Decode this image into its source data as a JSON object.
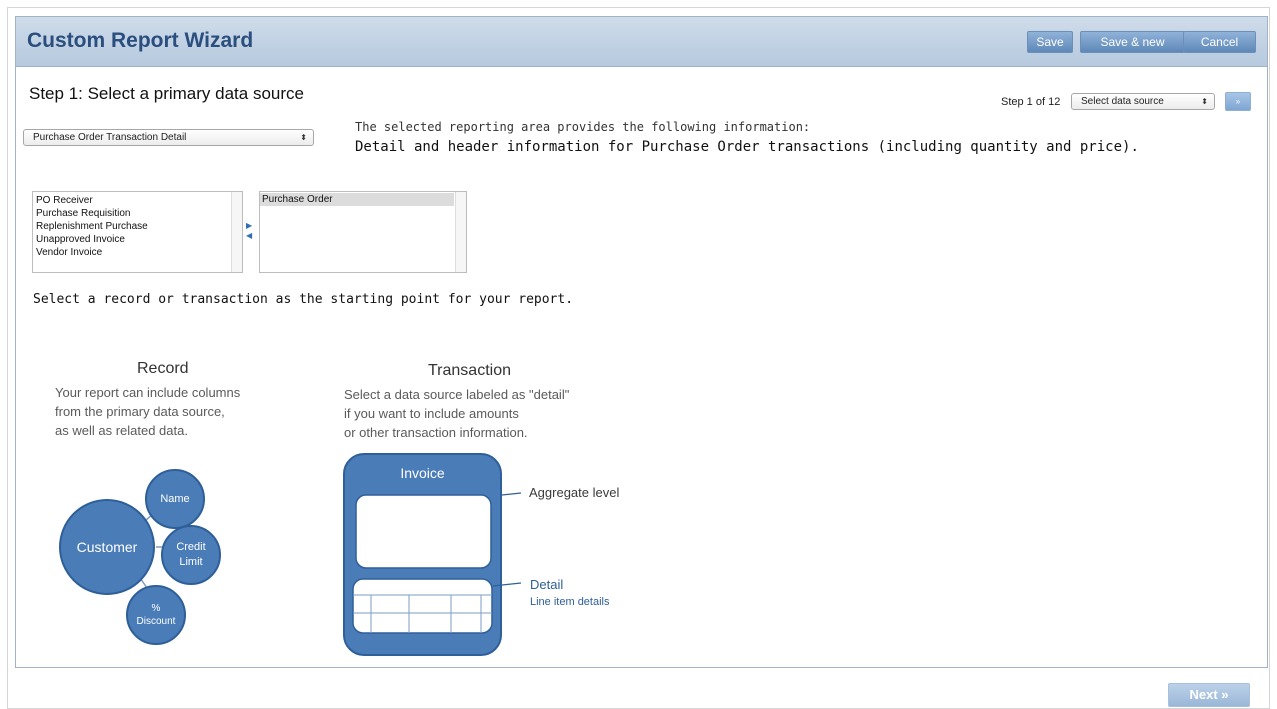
{
  "header": {
    "title": "Custom Report Wizard",
    "save_label": "Save",
    "save_new_label": "Save & new",
    "cancel_label": "Cancel"
  },
  "step": {
    "title": "Step 1: Select a primary data source",
    "counter": "Step 1 of 12",
    "select_value": "Select data source",
    "go_label": "»"
  },
  "data_source": {
    "selected": "Purchase Order Transaction Detail",
    "info_intro": "The selected reporting area provides the following information:",
    "info_detail": "Detail and header information for Purchase Order transactions (including quantity and price)."
  },
  "lists": {
    "available": [
      "PO Receiver",
      "Purchase Requisition",
      "Replenishment Purchase",
      "Unapproved Invoice",
      "Vendor Invoice"
    ],
    "selected": [
      "Purchase Order"
    ],
    "move_right": "▶",
    "move_left": "◀"
  },
  "instruction": "Select a record or transaction as the starting point for your report.",
  "record": {
    "heading": "Record",
    "text": [
      "Your report can include columns",
      "from the primary data source,",
      "as well as related data."
    ],
    "nodes": {
      "center": "Customer",
      "name": "Name",
      "credit": [
        "Credit",
        "Limit"
      ],
      "discount": [
        "%",
        "Discount"
      ]
    }
  },
  "transaction": {
    "heading": "Transaction",
    "text": [
      "Select a data source labeled as \"detail\"",
      "if you want to include amounts",
      "or other transaction information."
    ],
    "box_title": "Invoice",
    "aggregate_label": "Aggregate level",
    "detail_label": "Detail",
    "detail_sub": "Line item details"
  },
  "footer": {
    "next_label": "Next »"
  },
  "colors": {
    "header_title": "#2a4e7e",
    "diagram_fill": "#4a7cb8",
    "diagram_stroke": "#2e5f99",
    "button_blue": "#6f96c6"
  }
}
